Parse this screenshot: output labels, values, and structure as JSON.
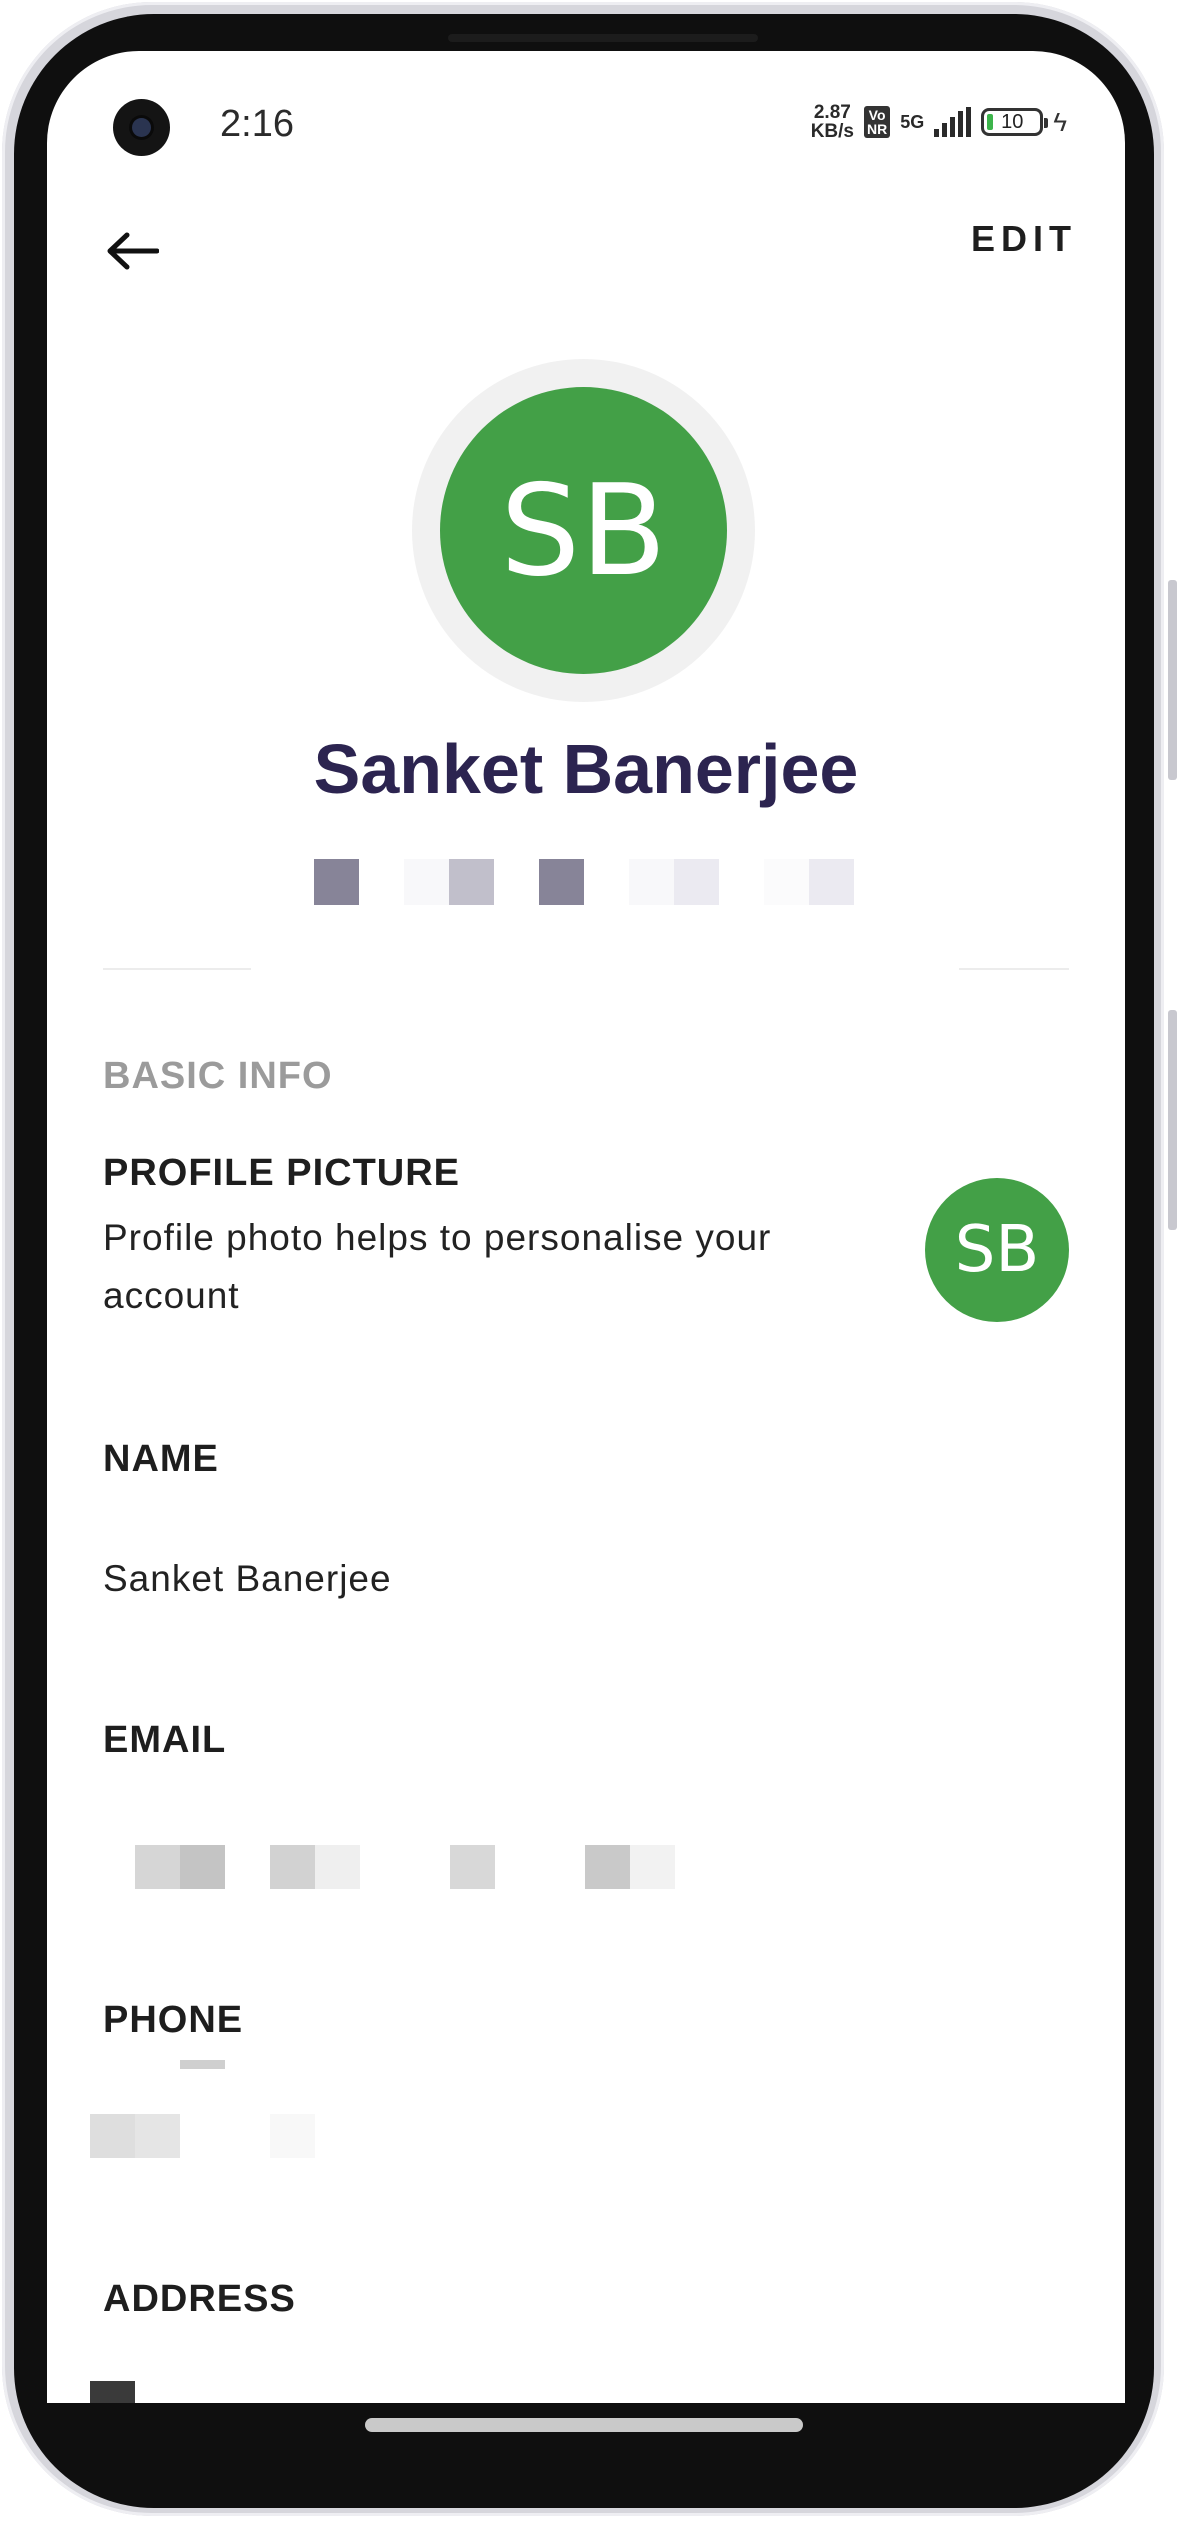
{
  "status_bar": {
    "time": "2:16",
    "speed_value": "2.87",
    "speed_unit": "KB/s",
    "volte_top": "Vo",
    "volte_bottom": "NR",
    "network": "5G",
    "battery": "10"
  },
  "header": {
    "edit_label": "EDIT"
  },
  "profile": {
    "initials": "SB",
    "name": "Sanket Banerjee",
    "avatar_color": "#43a047"
  },
  "basic_info": {
    "section_title": "BASIC INFO",
    "profile_picture_label": "PROFILE PICTURE",
    "profile_picture_desc_line1": "Profile photo helps to personalise your",
    "profile_picture_desc_line2": "account",
    "name_label": "NAME",
    "name_value": "Sanket Banerjee",
    "email_label": "EMAIL",
    "phone_label": "PHONE",
    "address_label": "ADDRESS"
  },
  "colors": {
    "title_color": "#2c2450",
    "accent_green": "#43a047",
    "section_grey": "#9b9b9b"
  }
}
